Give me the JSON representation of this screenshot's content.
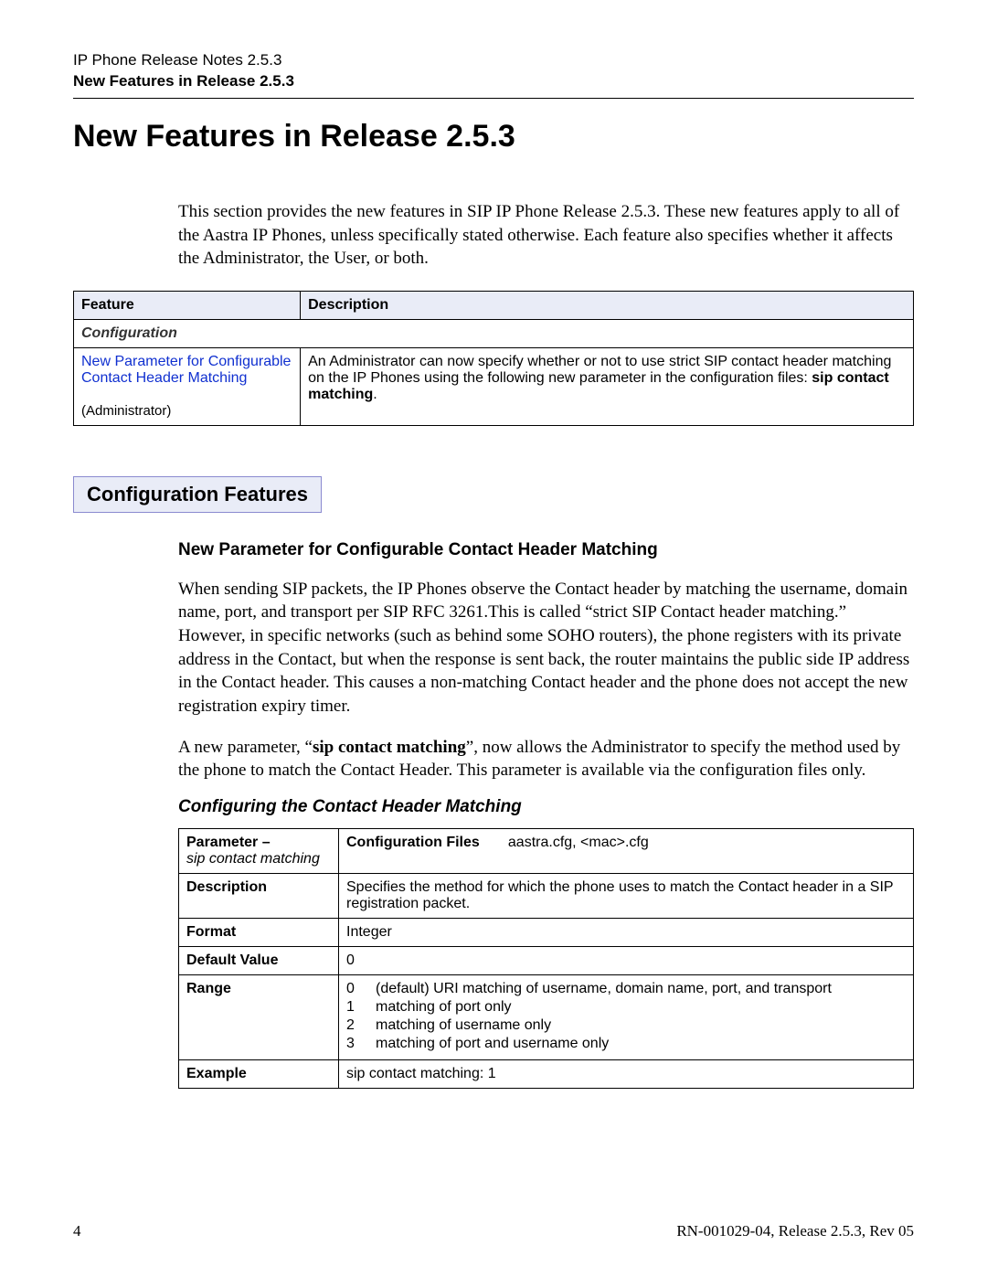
{
  "running_head": {
    "line1": "IP Phone Release Notes 2.5.3",
    "line2": "New Features in Release 2.5.3"
  },
  "main_title": "New Features in Release 2.5.3",
  "intro": "This section provides the new features in SIP IP Phone Release 2.5.3. These new features apply to all of the Aastra IP Phones, unless specifically stated otherwise. Each feature also specifies whether it affects the Administrator, the User, or both.",
  "feature_table": {
    "head_feature": "Feature",
    "head_desc": "Description",
    "category": "Configuration",
    "link_text": "New Parameter for Configurable Contact Header Matching",
    "role": "(Administrator)",
    "desc_pre": "An Administrator can now specify whether or not to use strict SIP contact header matching on the IP Phones using the following new parameter in the configuration files: ",
    "desc_bold": "sip contact matching",
    "desc_post": "."
  },
  "section_box": "Configuration Features",
  "subheading": "New Parameter for Configurable Contact Header Matching",
  "para1": "When sending SIP packets, the IP Phones observe the Contact header by matching the username, domain name, port, and transport per SIP RFC 3261.This is called “strict SIP Contact header matching.” However, in specific networks (such as behind some SOHO routers), the phone registers with its private address in the Contact, but when the response is sent back, the router maintains the public side IP address in the Contact header. This causes a non-matching Contact header and the phone does not accept the new registration expiry timer.",
  "para2_pre": "A new parameter, “",
  "para2_bold": "sip contact matching",
  "para2_post": "”, now allows the Administrator to specify the method used by the phone to match the Contact Header. This parameter is available via the configuration files only.",
  "sub_italic": "Configuring the Contact Header Matching",
  "param_table": {
    "param_label": "Parameter",
    "param_dash": " –",
    "param_name": "sip contact matching",
    "cf_label": "Configuration Files",
    "cf_value": "aastra.cfg, <mac>.cfg",
    "desc_label": "Description",
    "desc_value": "Specifies the method for which the phone uses to match the Contact header in a SIP registration packet.",
    "format_label": "Format",
    "format_value": "Integer",
    "default_label": "Default Value",
    "default_value": "0",
    "range_label": "Range",
    "range": [
      {
        "n": "0",
        "t": "(default) URI matching of username, domain name, port, and transport"
      },
      {
        "n": "1",
        "t": "matching of port only"
      },
      {
        "n": "2",
        "t": "matching of username only"
      },
      {
        "n": "3",
        "t": "matching of port and username only"
      }
    ],
    "example_label": "Example",
    "example_value": "sip contact matching: 1"
  },
  "footer": {
    "page": "4",
    "doc": "RN-001029-04, Release 2.5.3, Rev 05"
  }
}
